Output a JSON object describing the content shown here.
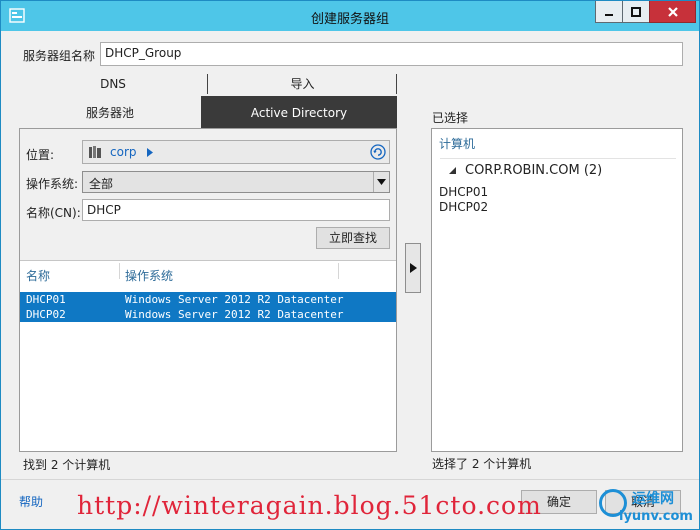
{
  "window": {
    "title": "创建服务器组",
    "controls": {
      "minimize": "minimize",
      "maximize": "maximize",
      "close": "close"
    }
  },
  "group_name": {
    "label": "服务器组名称",
    "value": "DHCP_Group"
  },
  "tabs_top": [
    {
      "label": "DNS"
    },
    {
      "label": "导入"
    }
  ],
  "tabs_second": [
    {
      "label": "服务器池",
      "selected": false
    },
    {
      "label": "Active Directory",
      "selected": true
    }
  ],
  "search": {
    "location_label": "位置:",
    "location_value": "corp",
    "os_label": "操作系统:",
    "os_value": "全部",
    "name_label": "名称(CN):",
    "name_value": "DHCP",
    "find_button": "立即查找"
  },
  "results": {
    "columns": [
      "名称",
      "操作系统"
    ],
    "rows": [
      {
        "name": "DHCP01",
        "os": "Windows Server 2012 R2 Datacenter",
        "selected": true
      },
      {
        "name": "DHCP02",
        "os": "Windows Server 2012 R2 Datacenter",
        "selected": true
      }
    ],
    "status": "找到 2 个计算机"
  },
  "selected": {
    "label": "已选择",
    "column": "计算机",
    "domain": "CORP.ROBIN.COM (2)",
    "items": [
      "DHCP01",
      "DHCP02"
    ],
    "status": "选择了 2 个计算机"
  },
  "footer": {
    "help": "帮助",
    "ok": "确定",
    "cancel": "取消"
  },
  "watermark": {
    "url": "http://winteragain.blog.51cto.com",
    "logo_cn": "运维网",
    "logo_en": "iyunv.com"
  },
  "colors": {
    "titlebar": "#4ec6e8",
    "selection": "#0f78c4",
    "tab_active": "#3a3a3a",
    "link": "#1566c0",
    "watermark": "#e0253a"
  }
}
